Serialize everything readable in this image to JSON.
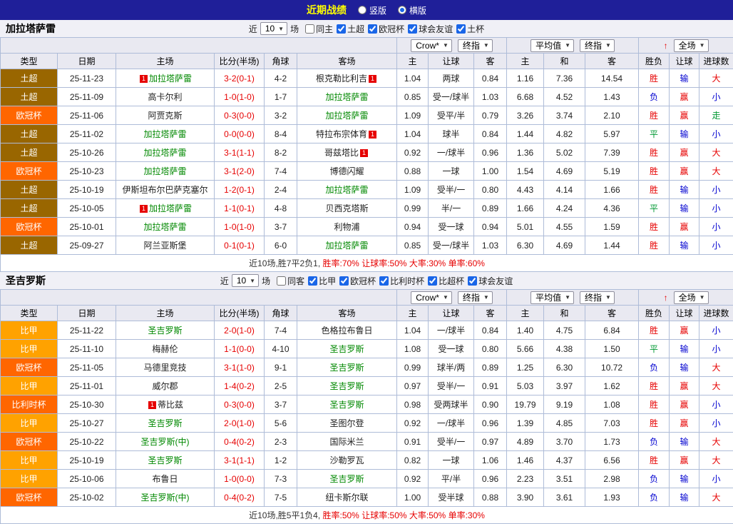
{
  "topbar": {
    "title": "近期战绩",
    "radios": [
      {
        "label": "竖版",
        "selected": false
      },
      {
        "label": "横版",
        "selected": true
      }
    ]
  },
  "icons": {
    "select_arrow": "▼",
    "sort": "↑"
  },
  "league_colors": {
    "土超": "#996600",
    "欧冠杯": "#ff6600",
    "比甲": "#ffa200",
    "比利时杯": "#ff6600"
  },
  "result_colors": {
    "胜": "#e60000",
    "赢": "#e60000",
    "大": "#e60000",
    "平": "#009933",
    "走": "#009933",
    "负": "#0000d0",
    "输": "#0000d0",
    "小": "#0000d0"
  },
  "sections": [
    {
      "team": "加拉塔萨雷",
      "filter": {
        "near_label": "近",
        "count": "10",
        "games_label": "场",
        "checkboxes": [
          {
            "label": "同主",
            "checked": false
          },
          {
            "label": "土超",
            "checked": true
          },
          {
            "label": "欧冠杯",
            "checked": true
          },
          {
            "label": "球会友谊",
            "checked": true
          },
          {
            "label": "土杯",
            "checked": true
          }
        ]
      },
      "selects": {
        "company": "Crow*",
        "company_stage": "终指",
        "europe": "平均值",
        "europe_stage": "终指",
        "scope": "全场"
      },
      "columns": [
        "类型",
        "日期",
        "主场",
        "比分(半场)",
        "角球",
        "客场",
        "主",
        "让球",
        "客",
        "主",
        "和",
        "客",
        "胜负",
        "让球",
        "进球数"
      ],
      "rows": [
        {
          "league": "土超",
          "date": "25-11-23",
          "home": {
            "name": "加拉塔萨雷",
            "self": true,
            "badge_before": "1"
          },
          "score": "3-2(0-1)",
          "corners": "4-2",
          "away": {
            "name": "根克勒比利吉",
            "badge_after": "1"
          },
          "odds": [
            "1.04",
            "两球",
            "0.84"
          ],
          "avg": [
            "1.16",
            "7.36",
            "14.54"
          ],
          "results": [
            "胜",
            "输",
            "大"
          ]
        },
        {
          "league": "土超",
          "date": "25-11-09",
          "home": {
            "name": "高卡尔利"
          },
          "score": "1-0(1-0)",
          "corners": "1-7",
          "away": {
            "name": "加拉塔萨雷",
            "self": true
          },
          "odds": [
            "0.85",
            "受一/球半",
            "1.03"
          ],
          "avg": [
            "6.68",
            "4.52",
            "1.43"
          ],
          "results": [
            "负",
            "赢",
            "小"
          ]
        },
        {
          "league": "欧冠杯",
          "date": "25-11-06",
          "home": {
            "name": "阿贾克斯"
          },
          "score": "0-3(0-0)",
          "corners": "3-2",
          "away": {
            "name": "加拉塔萨雷",
            "self": true
          },
          "odds": [
            "1.09",
            "受平/半",
            "0.79"
          ],
          "avg": [
            "3.26",
            "3.74",
            "2.10"
          ],
          "results": [
            "胜",
            "赢",
            "走"
          ]
        },
        {
          "league": "土超",
          "date": "25-11-02",
          "home": {
            "name": "加拉塔萨雷",
            "self": true
          },
          "score": "0-0(0-0)",
          "corners": "8-4",
          "away": {
            "name": "特拉布宗体育",
            "badge_after": "1"
          },
          "odds": [
            "1.04",
            "球半",
            "0.84"
          ],
          "avg": [
            "1.44",
            "4.82",
            "5.97"
          ],
          "results": [
            "平",
            "输",
            "小"
          ]
        },
        {
          "league": "土超",
          "date": "25-10-26",
          "home": {
            "name": "加拉塔萨雷",
            "self": true
          },
          "score": "3-1(1-1)",
          "corners": "8-2",
          "away": {
            "name": "哥兹塔比",
            "badge_after": "1"
          },
          "odds": [
            "0.92",
            "一/球半",
            "0.96"
          ],
          "avg": [
            "1.36",
            "5.02",
            "7.39"
          ],
          "results": [
            "胜",
            "赢",
            "大"
          ]
        },
        {
          "league": "欧冠杯",
          "date": "25-10-23",
          "home": {
            "name": "加拉塔萨雷",
            "self": true
          },
          "score": "3-1(2-0)",
          "corners": "7-4",
          "away": {
            "name": "博德闪耀"
          },
          "odds": [
            "0.88",
            "一球",
            "1.00"
          ],
          "avg": [
            "1.54",
            "4.69",
            "5.19"
          ],
          "results": [
            "胜",
            "赢",
            "大"
          ]
        },
        {
          "league": "土超",
          "date": "25-10-19",
          "home": {
            "name": "伊斯坦布尔巴萨克塞尔"
          },
          "score": "1-2(0-1)",
          "corners": "2-4",
          "away": {
            "name": "加拉塔萨雷",
            "self": true
          },
          "odds": [
            "1.09",
            "受半/一",
            "0.80"
          ],
          "avg": [
            "4.43",
            "4.14",
            "1.66"
          ],
          "results": [
            "胜",
            "输",
            "小"
          ]
        },
        {
          "league": "土超",
          "date": "25-10-05",
          "home": {
            "name": "加拉塔萨雷",
            "self": true,
            "badge_before": "1"
          },
          "score": "1-1(0-1)",
          "corners": "4-8",
          "away": {
            "name": "贝西克塔斯"
          },
          "odds": [
            "0.99",
            "半/一",
            "0.89"
          ],
          "avg": [
            "1.66",
            "4.24",
            "4.36"
          ],
          "results": [
            "平",
            "输",
            "小"
          ]
        },
        {
          "league": "欧冠杯",
          "date": "25-10-01",
          "home": {
            "name": "加拉塔萨雷",
            "self": true
          },
          "score": "1-0(1-0)",
          "corners": "3-7",
          "away": {
            "name": "利物浦"
          },
          "odds": [
            "0.94",
            "受一球",
            "0.94"
          ],
          "avg": [
            "5.01",
            "4.55",
            "1.59"
          ],
          "results": [
            "胜",
            "赢",
            "小"
          ]
        },
        {
          "league": "土超",
          "date": "25-09-27",
          "home": {
            "name": "阿兰亚斯堡"
          },
          "score": "0-1(0-1)",
          "corners": "6-0",
          "away": {
            "name": "加拉塔萨雷",
            "self": true
          },
          "odds": [
            "0.85",
            "受一/球半",
            "1.03"
          ],
          "avg": [
            "6.30",
            "4.69",
            "1.44"
          ],
          "results": [
            "胜",
            "输",
            "小"
          ]
        }
      ],
      "summary": [
        {
          "text": "近10场,胜7平2负1, ",
          "color": "#333333"
        },
        {
          "text": "胜率:70% ",
          "color": "#e60000"
        },
        {
          "text": "让球率:50% ",
          "color": "#e60000"
        },
        {
          "text": "大率:30% ",
          "color": "#e60000"
        },
        {
          "text": "单率:60%",
          "color": "#e60000"
        }
      ]
    },
    {
      "team": "圣吉罗斯",
      "filter": {
        "near_label": "近",
        "count": "10",
        "games_label": "场",
        "checkboxes": [
          {
            "label": "同客",
            "checked": false
          },
          {
            "label": "比甲",
            "checked": true
          },
          {
            "label": "欧冠杯",
            "checked": true
          },
          {
            "label": "比利时杯",
            "checked": true
          },
          {
            "label": "比超杯",
            "checked": true
          },
          {
            "label": "球会友谊",
            "checked": true
          }
        ]
      },
      "selects": {
        "company": "Crow*",
        "company_stage": "终指",
        "europe": "平均值",
        "europe_stage": "终指",
        "scope": "全场"
      },
      "columns": [
        "类型",
        "日期",
        "主场",
        "比分(半场)",
        "角球",
        "客场",
        "主",
        "让球",
        "客",
        "主",
        "和",
        "客",
        "胜负",
        "让球",
        "进球数"
      ],
      "rows": [
        {
          "league": "比甲",
          "date": "25-11-22",
          "home": {
            "name": "圣吉罗斯",
            "self": true
          },
          "score": "2-0(1-0)",
          "corners": "7-4",
          "away": {
            "name": "色格拉布鲁日"
          },
          "odds": [
            "1.04",
            "一/球半",
            "0.84"
          ],
          "avg": [
            "1.40",
            "4.75",
            "6.84"
          ],
          "results": [
            "胜",
            "赢",
            "小"
          ]
        },
        {
          "league": "比甲",
          "date": "25-11-10",
          "home": {
            "name": "梅赫伦"
          },
          "score": "1-1(0-0)",
          "corners": "4-10",
          "away": {
            "name": "圣吉罗斯",
            "self": true
          },
          "odds": [
            "1.08",
            "受一球",
            "0.80"
          ],
          "avg": [
            "5.66",
            "4.38",
            "1.50"
          ],
          "results": [
            "平",
            "输",
            "小"
          ]
        },
        {
          "league": "欧冠杯",
          "date": "25-11-05",
          "home": {
            "name": "马德里竞技"
          },
          "score": "3-1(1-0)",
          "corners": "9-1",
          "away": {
            "name": "圣吉罗斯",
            "self": true
          },
          "odds": [
            "0.99",
            "球半/两",
            "0.89"
          ],
          "avg": [
            "1.25",
            "6.30",
            "10.72"
          ],
          "results": [
            "负",
            "输",
            "大"
          ]
        },
        {
          "league": "比甲",
          "date": "25-11-01",
          "home": {
            "name": "威尔郡"
          },
          "score": "1-4(0-2)",
          "corners": "2-5",
          "away": {
            "name": "圣吉罗斯",
            "self": true
          },
          "odds": [
            "0.97",
            "受半/一",
            "0.91"
          ],
          "avg": [
            "5.03",
            "3.97",
            "1.62"
          ],
          "results": [
            "胜",
            "赢",
            "大"
          ]
        },
        {
          "league": "比利时杯",
          "date": "25-10-30",
          "home": {
            "name": "蒂比兹",
            "badge_before": "1"
          },
          "score": "0-3(0-0)",
          "corners": "3-7",
          "away": {
            "name": "圣吉罗斯",
            "self": true
          },
          "odds": [
            "0.98",
            "受两球半",
            "0.90"
          ],
          "avg": [
            "19.79",
            "9.19",
            "1.08"
          ],
          "results": [
            "胜",
            "赢",
            "小"
          ]
        },
        {
          "league": "比甲",
          "date": "25-10-27",
          "home": {
            "name": "圣吉罗斯",
            "self": true
          },
          "score": "2-0(1-0)",
          "corners": "5-6",
          "away": {
            "name": "圣图尔登"
          },
          "odds": [
            "0.92",
            "一/球半",
            "0.96"
          ],
          "avg": [
            "1.39",
            "4.85",
            "7.03"
          ],
          "results": [
            "胜",
            "赢",
            "小"
          ]
        },
        {
          "league": "欧冠杯",
          "date": "25-10-22",
          "home": {
            "name": "圣吉罗斯(中)",
            "self": true
          },
          "score": "0-4(0-2)",
          "corners": "2-3",
          "away": {
            "name": "国际米兰"
          },
          "odds": [
            "0.91",
            "受半/一",
            "0.97"
          ],
          "avg": [
            "4.89",
            "3.70",
            "1.73"
          ],
          "results": [
            "负",
            "输",
            "大"
          ]
        },
        {
          "league": "比甲",
          "date": "25-10-19",
          "home": {
            "name": "圣吉罗斯",
            "self": true
          },
          "score": "3-1(1-1)",
          "corners": "1-2",
          "away": {
            "name": "沙勒罗瓦"
          },
          "odds": [
            "0.82",
            "一球",
            "1.06"
          ],
          "avg": [
            "1.46",
            "4.37",
            "6.56"
          ],
          "results": [
            "胜",
            "赢",
            "大"
          ]
        },
        {
          "league": "比甲",
          "date": "25-10-06",
          "home": {
            "name": "布鲁日"
          },
          "score": "1-0(0-0)",
          "corners": "7-3",
          "away": {
            "name": "圣吉罗斯",
            "self": true
          },
          "odds": [
            "0.92",
            "平/半",
            "0.96"
          ],
          "avg": [
            "2.23",
            "3.51",
            "2.98"
          ],
          "results": [
            "负",
            "输",
            "小"
          ]
        },
        {
          "league": "欧冠杯",
          "date": "25-10-02",
          "home": {
            "name": "圣吉罗斯(中)",
            "self": true
          },
          "score": "0-4(0-2)",
          "corners": "7-5",
          "away": {
            "name": "纽卡斯尔联"
          },
          "odds": [
            "1.00",
            "受半球",
            "0.88"
          ],
          "avg": [
            "3.90",
            "3.61",
            "1.93"
          ],
          "results": [
            "负",
            "输",
            "大"
          ]
        }
      ],
      "summary": [
        {
          "text": "近10场,胜5平1负4, ",
          "color": "#333333"
        },
        {
          "text": "胜率:50% ",
          "color": "#e60000"
        },
        {
          "text": "让球率:50% ",
          "color": "#e60000"
        },
        {
          "text": "大率:50% ",
          "color": "#e60000"
        },
        {
          "text": "单率:30%",
          "color": "#e60000"
        }
      ]
    }
  ]
}
